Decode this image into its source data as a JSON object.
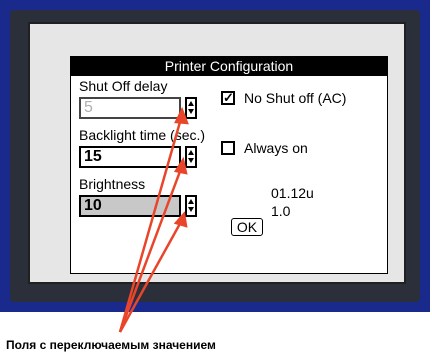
{
  "dialog": {
    "title": "Printer Configuration",
    "shut_off_delay": {
      "label": "Shut Off delay",
      "value": "5"
    },
    "backlight_time": {
      "label": "Backlight time (sec.)",
      "value": "15"
    },
    "brightness": {
      "label": "Brightness",
      "value": "10"
    },
    "no_shut_off": {
      "label": "No Shut off (AC)",
      "checked": true,
      "mark": "✓"
    },
    "always_on": {
      "label": "Always on",
      "checked": false
    },
    "version_line1": "01.12u",
    "version_line2": "1.0",
    "ok_label": "OK"
  },
  "annotation": {
    "caption": "Поля с переключаемым значением",
    "arrow_color": "#e8452a"
  }
}
